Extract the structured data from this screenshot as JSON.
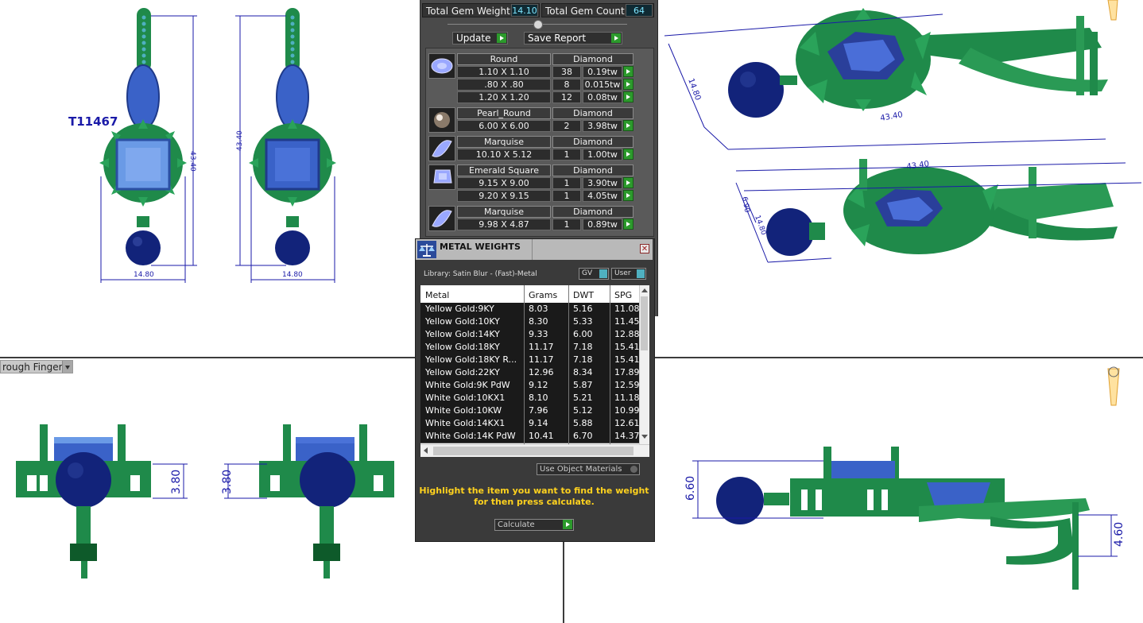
{
  "left_top_view": {
    "model_label": "T11467",
    "dims": [
      "43.40",
      "43.40",
      "14.80",
      "14.80"
    ]
  },
  "right_top_view": {
    "dims": [
      "14.80",
      "43.40",
      "43.40",
      "6.90",
      "14.80"
    ]
  },
  "bottom_left_view": {
    "dropdown_label": "rough Finger",
    "dims": [
      "3.80",
      "3.80"
    ]
  },
  "bottom_right_view": {
    "dims": [
      "6.60",
      "4.60"
    ]
  },
  "gem_panel": {
    "total_weight_label": "Total Gem Weight",
    "total_weight_value": "14.10",
    "total_count_label": "Total Gem Count",
    "total_count_value": "64",
    "update_label": "Update",
    "save_report_label": "Save Report",
    "groups": [
      {
        "icon": "round-gem-icon",
        "shape": "Round",
        "material": "Diamond",
        "rows": [
          {
            "size": "1.10 X 1.10",
            "count": "38",
            "weight": "0.19tw"
          },
          {
            "size": ".80 X .80",
            "count": "8",
            "weight": "0.015tw"
          },
          {
            "size": "1.20 X 1.20",
            "count": "12",
            "weight": "0.08tw"
          }
        ]
      },
      {
        "icon": "pearl-icon",
        "shape": "Pearl_Round",
        "material": "Diamond",
        "rows": [
          {
            "size": "6.00 X 6.00",
            "count": "2",
            "weight": "3.98tw"
          }
        ]
      },
      {
        "icon": "marquise-gem-icon",
        "shape": "Marquise",
        "material": "Diamond",
        "rows": [
          {
            "size": "10.10 X 5.12",
            "count": "1",
            "weight": "1.00tw"
          }
        ]
      },
      {
        "icon": "emerald-square-gem-icon",
        "shape": "Emerald Square",
        "material": "Diamond",
        "rows": [
          {
            "size": "9.15 X 9.00",
            "count": "1",
            "weight": "3.90tw"
          },
          {
            "size": "9.20 X 9.15",
            "count": "1",
            "weight": "4.05tw"
          }
        ]
      },
      {
        "icon": "marquise-gem-icon",
        "shape": "Marquise",
        "material": "Diamond",
        "rows": [
          {
            "size": "9.98 X 4.87",
            "count": "1",
            "weight": "0.89tw"
          }
        ]
      }
    ]
  },
  "metal_panel": {
    "title": "METAL WEIGHTS",
    "library": "Library: Satin Blur - (Fast)-Metal",
    "gv_label": "GV",
    "user_label": "User",
    "columns": [
      "Metal",
      "Grams",
      "DWT",
      "SPG"
    ],
    "rows": [
      [
        "Yellow Gold:9KY",
        "8.03",
        "5.16",
        "11.08"
      ],
      [
        "Yellow Gold:10KY",
        "8.30",
        "5.33",
        "11.45"
      ],
      [
        "Yellow Gold:14KY",
        "9.33",
        "6.00",
        "12.88"
      ],
      [
        "Yellow Gold:18KY",
        "11.17",
        "7.18",
        "15.41"
      ],
      [
        "Yellow Gold:18KY R...",
        "11.17",
        "7.18",
        "15.41"
      ],
      [
        "Yellow Gold:22KY",
        "12.96",
        "8.34",
        "17.89"
      ],
      [
        "White Gold:9K PdW",
        "9.12",
        "5.87",
        "12.59"
      ],
      [
        "White Gold:10KX1",
        "8.10",
        "5.21",
        "11.18"
      ],
      [
        "White Gold:10KW",
        "7.96",
        "5.12",
        "10.99"
      ],
      [
        "White Gold:14KX1",
        "9.14",
        "5.88",
        "12.61"
      ],
      [
        "White Gold:14K PdW",
        "10.41",
        "6.70",
        "14.37"
      ]
    ],
    "use_object_materials": "Use Object Materials",
    "message_line1": "Highlight the item you want to find the weight",
    "message_line2": "for then press calculate.",
    "calculate_label": "Calculate"
  },
  "colors": {
    "metal_green": "#1f8a4a",
    "gem_blue": "#3a62c8",
    "pearl_navy": "#12237a",
    "dimension_blue": "#1a1aa8",
    "panel_gray": "#4a4a4a"
  }
}
